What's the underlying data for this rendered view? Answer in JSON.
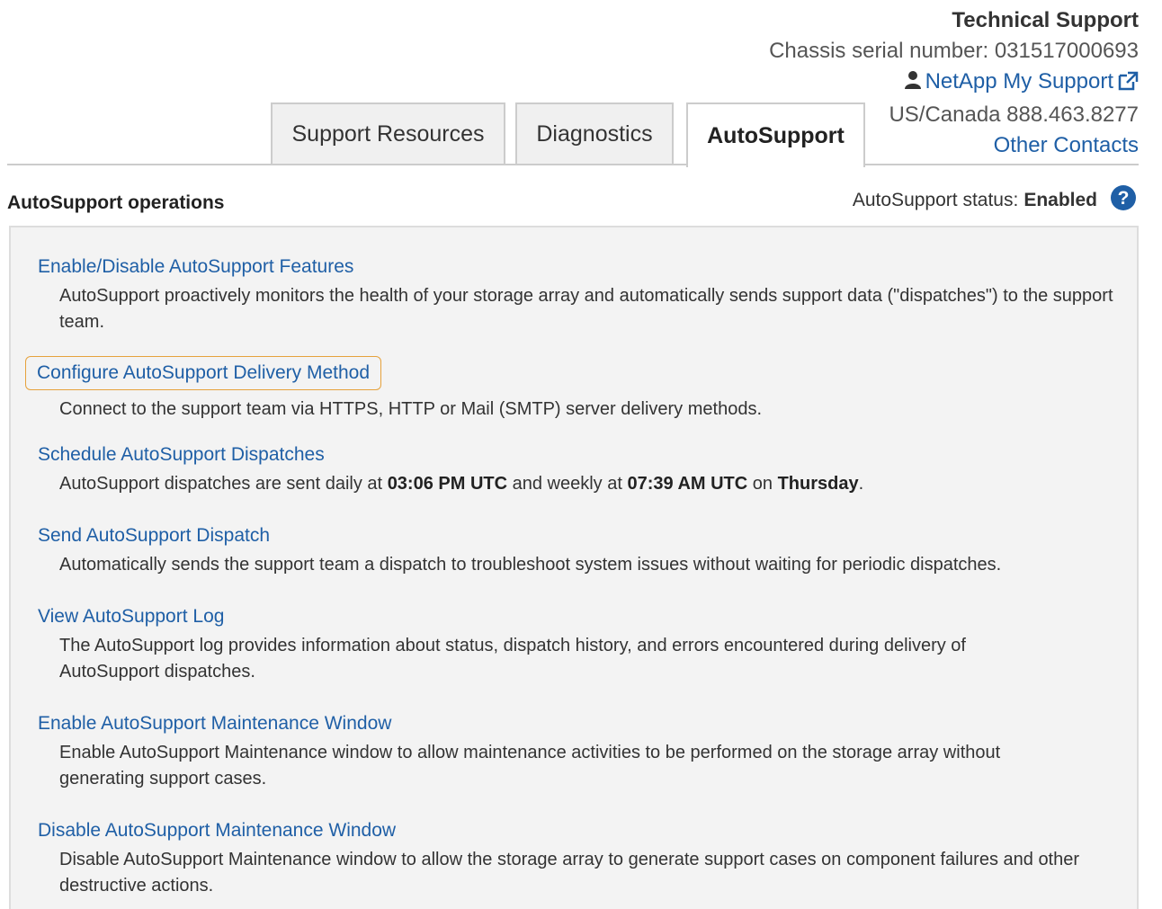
{
  "header": {
    "title": "Technical Support",
    "serial": "Chassis serial number: 031517000693",
    "support_link": "NetApp My Support",
    "phone": "US/Canada 888.463.8277",
    "contacts_link": "Other Contacts"
  },
  "tabs": [
    {
      "label": "Support Resources",
      "active": false
    },
    {
      "label": "Diagnostics",
      "active": false
    },
    {
      "label": "AutoSupport",
      "active": true
    }
  ],
  "section": {
    "title": "AutoSupport operations",
    "status_label": "AutoSupport status:",
    "status_value": "Enabled"
  },
  "operations": [
    {
      "link": "Enable/Disable AutoSupport Features",
      "desc": "AutoSupport proactively monitors the health of your storage array and automatically sends support data (\"dispatches\") to the support team."
    },
    {
      "link": "Configure AutoSupport Delivery Method",
      "desc": "Connect to the support team via HTTPS, HTTP or Mail (SMTP) server delivery methods."
    },
    {
      "link": "Schedule AutoSupport Dispatches",
      "desc_prefix": "AutoSupport dispatches are sent daily at",
      "daily_time": "03:06 PM UTC",
      "desc_mid": "and weekly at",
      "weekly_time": "07:39 AM UTC",
      "desc_on": "on",
      "weekday": "Thursday",
      "desc_end": "."
    },
    {
      "link": "Send AutoSupport Dispatch",
      "desc": "Automatically sends the support team a dispatch to troubleshoot system issues without waiting for periodic dispatches."
    },
    {
      "link": "View AutoSupport Log",
      "desc": "The AutoSupport log provides information about status, dispatch history, and errors encountered during delivery of AutoSupport dispatches."
    },
    {
      "link": "Enable AutoSupport Maintenance Window",
      "desc": "Enable AutoSupport Maintenance window to allow maintenance activities to be performed on the storage array without generating support cases."
    },
    {
      "link": "Disable AutoSupport Maintenance Window",
      "desc": "Disable AutoSupport Maintenance window to allow the storage array to generate support cases on component failures and other destructive actions."
    }
  ],
  "colors": {
    "link": "#1f5fa6",
    "highlight": "#e6a23c",
    "help_icon": "#1f5fa6"
  },
  "icons": [
    "user-icon",
    "external-link-icon",
    "help-icon"
  ]
}
